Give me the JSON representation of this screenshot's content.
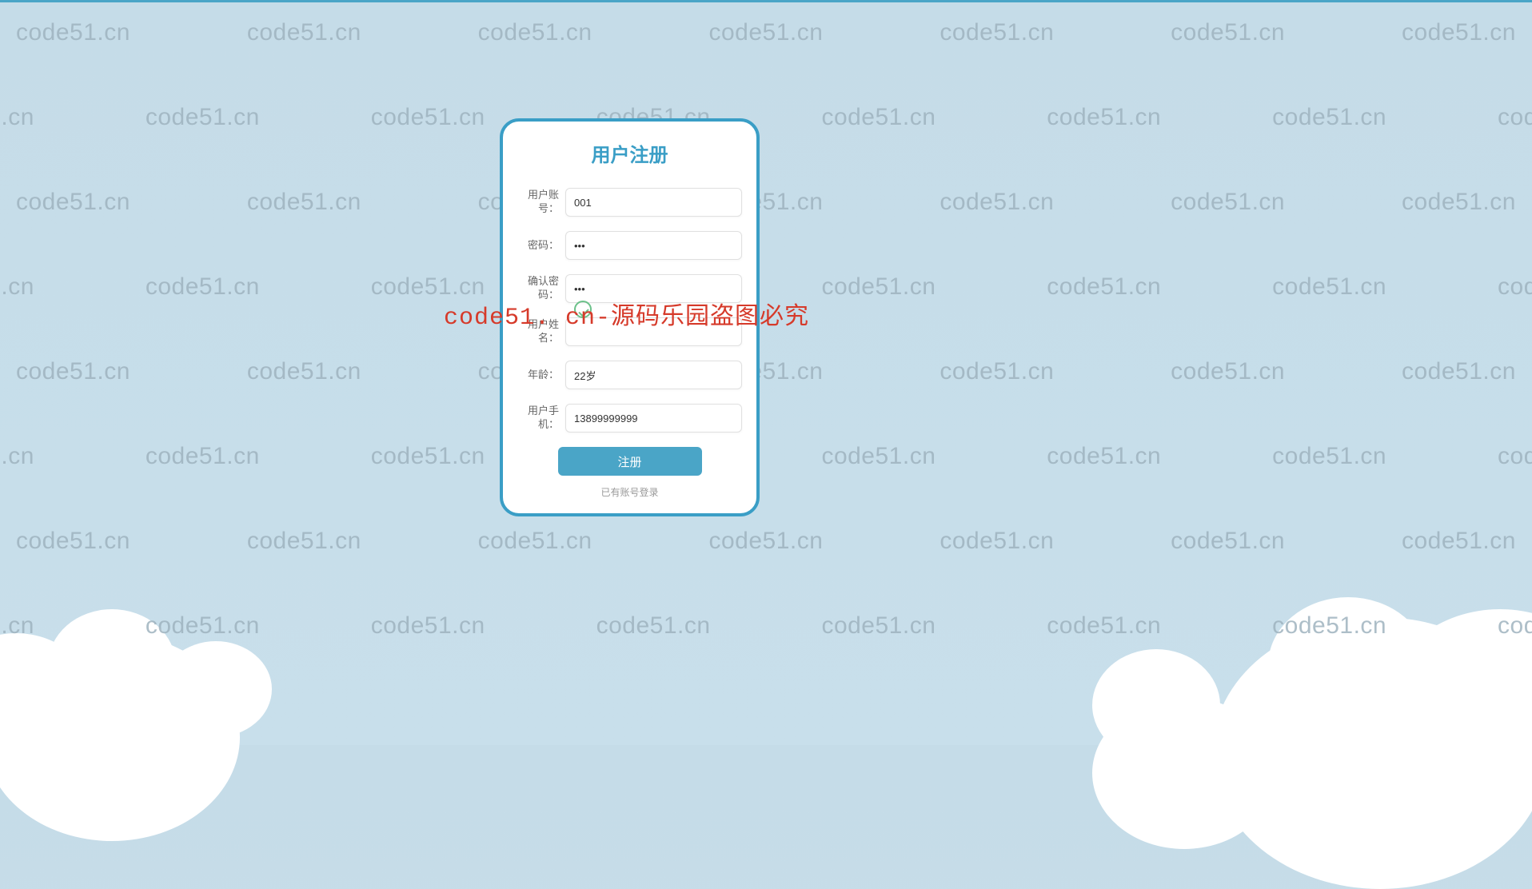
{
  "watermark_text": "code51.cn",
  "overlay_text": "code51. cn-源码乐园盗图必究",
  "card": {
    "title": "用户注册",
    "fields": {
      "account_label": "用户账号：",
      "account_value": "001",
      "password_label": "密码：",
      "password_value": "•••",
      "confirm_label": "确认密码：",
      "confirm_value": "•••",
      "username_label": "用户姓名：",
      "username_value": "",
      "age_label": "年龄：",
      "age_value": "22岁",
      "phone_label": "用户手机：",
      "phone_value": "13899999999"
    },
    "submit_label": "注册",
    "login_link_label": "已有账号登录"
  },
  "colors": {
    "brand": "#3a9ec6",
    "button": "#4aa5c7",
    "overlay_red": "#d63a2a",
    "watermark": "#9fb3bf"
  }
}
